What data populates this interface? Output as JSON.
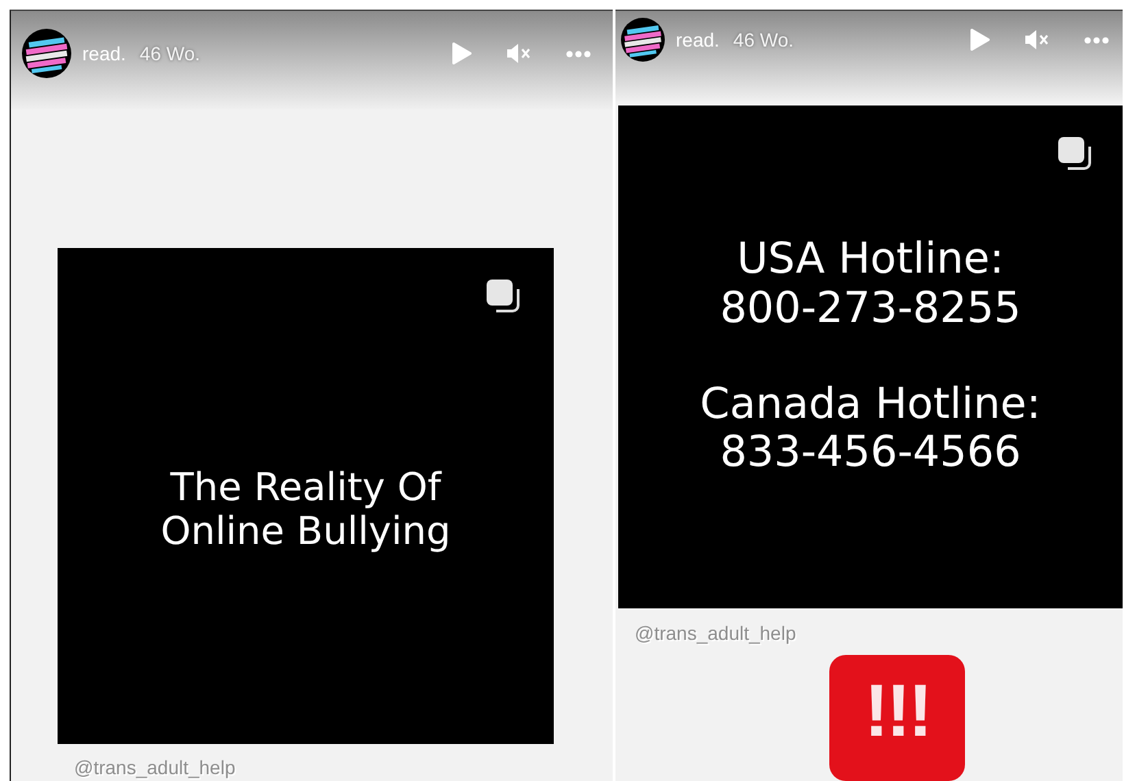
{
  "stories": [
    {
      "account": "read.",
      "age": "46 Wo.",
      "post": {
        "blocks": [
          "The Reality Of\nOnline Bullying"
        ]
      },
      "handle": "@trans_adult_help"
    },
    {
      "account": "read.",
      "age": "46 Wo.",
      "post": {
        "blocks": [
          "USA Hotline:\n800-273-8255",
          "Canada Hotline:\n833-456-4566"
        ]
      },
      "handle": "@trans_adult_help",
      "sticker": "!!!"
    }
  ]
}
